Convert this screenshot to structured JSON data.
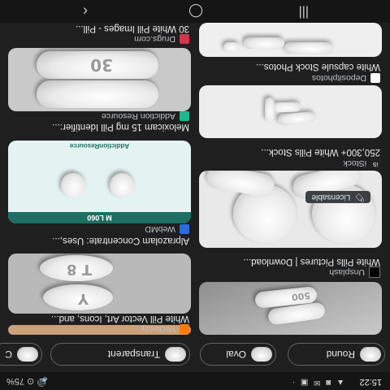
{
  "status_bar": {
    "time": "15:22",
    "notifications": "▲ ◙ ✉ ▣ ·",
    "right": "🔊 ⊙ 75%"
  },
  "chips": [
    {
      "label": "Round",
      "icon": "round-pill-thumb"
    },
    {
      "label": "Oval",
      "icon": "oval-pill-thumb"
    },
    {
      "label": "Transparent",
      "icon": "transparent-pill-thumb"
    },
    {
      "label": "C",
      "icon": "capsule-pill-thumb"
    }
  ],
  "results": {
    "left": [
      {
        "source": "Unsplash",
        "caption": "White Pills Pictures | Download...",
        "fav_color": "#000000"
      },
      {
        "source": "iStock",
        "caption": "250,300+ White Pills Stock...",
        "fav_color": "#222222",
        "fav_text": "iS"
      },
      {
        "source": "Depositphotos",
        "caption": "White capsule Stock Photos...",
        "fav_color": "#ffffff"
      }
    ],
    "right": [
      {
        "source": "Vecteezy",
        "caption": "White Pill Vector Art, Icons, and...",
        "fav_color": "#ff7a00"
      },
      {
        "source": "WebMD",
        "caption": "Alprazolam Concentrate: Uses,...",
        "fav_color": "#2b6cdf",
        "image_label": "M L060",
        "image_brand": "AddictionResource"
      },
      {
        "source": "Addiction Resource",
        "caption": "Meloxicam 15 mg Pill Identifier:...",
        "fav_color": "#1fb58f"
      },
      {
        "source": "Drugs.com",
        "caption": "30 White Pill Images - Pill...",
        "fav_color": "#d0364c"
      }
    ]
  },
  "badge": {
    "label": "Licensable"
  },
  "imprints": {
    "vecteezy_top": "T 8",
    "vecteezy_bottom": "Y",
    "meloxicam": "30",
    "unsplash": "500"
  },
  "nav": {
    "back": "‹",
    "home": "◯",
    "recents": "|||"
  }
}
